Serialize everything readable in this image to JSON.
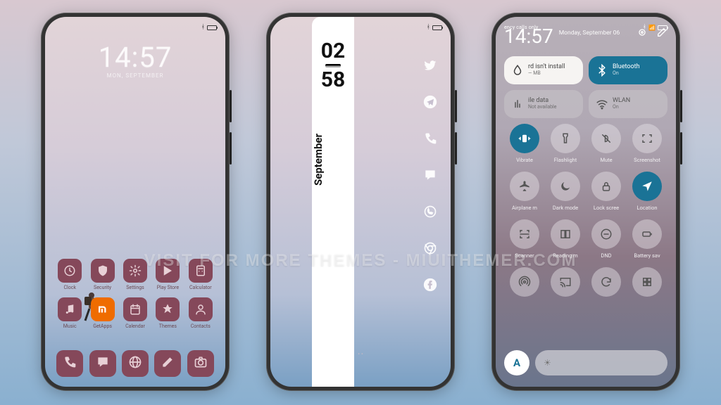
{
  "watermark": "VISIT FOR MORE THEMES - MIUITHEMER.COM",
  "phone1": {
    "clock": {
      "time": "14:57",
      "date": "MON, SEPTEMBER"
    },
    "status_icons": [
      "bluetooth-icon",
      "battery-icon"
    ],
    "apps_row1": [
      {
        "name": "Clock",
        "icon": "clock"
      },
      {
        "name": "Security",
        "icon": "shield"
      },
      {
        "name": "Settings",
        "icon": "gear"
      },
      {
        "name": "Play Store",
        "icon": "play"
      },
      {
        "name": "Calculator",
        "icon": "calc"
      }
    ],
    "apps_row2": [
      {
        "name": "Music",
        "icon": "music"
      },
      {
        "name": "GetApps",
        "icon": "mi",
        "variant": "getapps"
      },
      {
        "name": "Calendar",
        "icon": "calendar"
      },
      {
        "name": "Themes",
        "icon": "themes"
      },
      {
        "name": "Contacts",
        "icon": "contacts"
      }
    ],
    "dock": [
      {
        "name": "Phone",
        "icon": "phone"
      },
      {
        "name": "Messaging",
        "icon": "message"
      },
      {
        "name": "Browser",
        "icon": "globe"
      },
      {
        "name": "Notes",
        "icon": "pencil"
      },
      {
        "name": "Camera",
        "icon": "camera"
      }
    ]
  },
  "phone2": {
    "status_icons": [
      "bluetooth-icon",
      "battery-icon"
    ],
    "clock": {
      "hour": "02",
      "minute": "58"
    },
    "month": "September",
    "shortcuts": [
      {
        "name": "Twitter",
        "icon": "twitter"
      },
      {
        "name": "Telegram",
        "icon": "telegram"
      },
      {
        "name": "Phone",
        "icon": "phone"
      },
      {
        "name": "Messages",
        "icon": "message"
      },
      {
        "name": "WhatsApp",
        "icon": "whatsapp"
      },
      {
        "name": "Chrome",
        "icon": "chrome"
      },
      {
        "name": "Facebook",
        "icon": "facebook"
      }
    ]
  },
  "phone3": {
    "status_left": "ency calls only",
    "status_icons": [
      "bluetooth-icon",
      "signal-icon",
      "battery-icon"
    ],
    "clock": {
      "time": "14:57",
      "date": "Monday, September 06"
    },
    "header_actions": [
      "settings-shortcut-icon",
      "edit-icon"
    ],
    "main_toggles": [
      {
        "title": "rd isn't install",
        "sub": "— MB",
        "style": "white",
        "icon": "drop"
      },
      {
        "title": "Bluetooth",
        "sub": "On",
        "style": "blue",
        "icon": "bluetooth"
      },
      {
        "title": "ile data",
        "sub": "Not available",
        "style": "grey",
        "icon": "data"
      },
      {
        "title": "WLAN",
        "sub": "On",
        "style": "grey",
        "icon": "wifi"
      }
    ],
    "quick_toggles": [
      {
        "label": "Vibrate",
        "icon": "vibrate",
        "on": true
      },
      {
        "label": "Flashlight",
        "icon": "flashlight",
        "on": false
      },
      {
        "label": "Mute",
        "icon": "mute",
        "on": false
      },
      {
        "label": "Screenshot",
        "icon": "screenshot",
        "on": false
      },
      {
        "label": "Airplane m",
        "icon": "airplane",
        "on": false
      },
      {
        "label": "Dark mode",
        "icon": "darkmode",
        "on": false
      },
      {
        "label": "Lock scree",
        "icon": "lock",
        "on": false
      },
      {
        "label": "Location",
        "icon": "location",
        "on": true
      },
      {
        "label": "Scanner",
        "icon": "scanner",
        "on": false
      },
      {
        "label": "Reading m",
        "icon": "reading",
        "on": false
      },
      {
        "label": "DND",
        "icon": "dnd",
        "on": false
      },
      {
        "label": "Battery sav",
        "icon": "battery",
        "on": false
      },
      {
        "label": "",
        "icon": "hotspot",
        "on": false
      },
      {
        "label": "",
        "icon": "cast",
        "on": false
      },
      {
        "label": "",
        "icon": "sync",
        "on": false
      },
      {
        "label": "",
        "icon": "more",
        "on": false
      }
    ],
    "brightness": {
      "auto_label": "A"
    }
  }
}
